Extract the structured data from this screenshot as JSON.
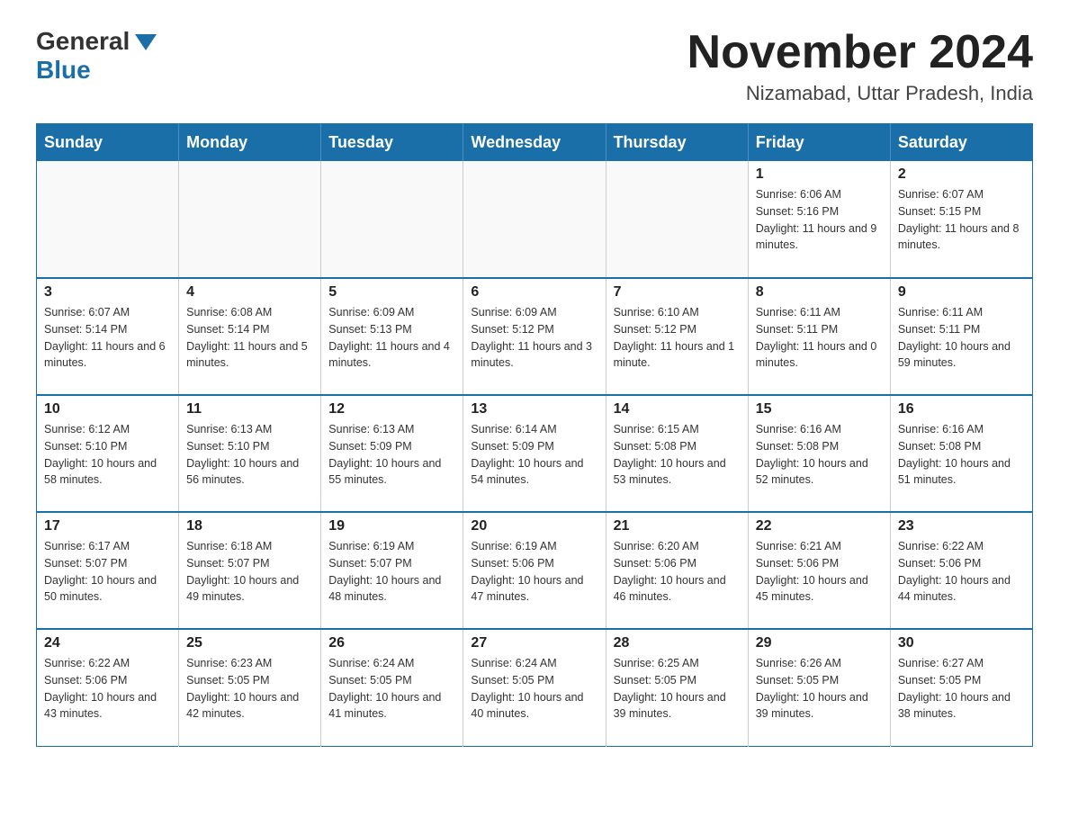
{
  "header": {
    "logo": {
      "general": "General",
      "blue": "Blue"
    },
    "title": "November 2024",
    "location": "Nizamabad, Uttar Pradesh, India"
  },
  "calendar": {
    "days_of_week": [
      "Sunday",
      "Monday",
      "Tuesday",
      "Wednesday",
      "Thursday",
      "Friday",
      "Saturday"
    ],
    "weeks": [
      [
        {
          "day": "",
          "info": ""
        },
        {
          "day": "",
          "info": ""
        },
        {
          "day": "",
          "info": ""
        },
        {
          "day": "",
          "info": ""
        },
        {
          "day": "",
          "info": ""
        },
        {
          "day": "1",
          "info": "Sunrise: 6:06 AM\nSunset: 5:16 PM\nDaylight: 11 hours and 9 minutes."
        },
        {
          "day": "2",
          "info": "Sunrise: 6:07 AM\nSunset: 5:15 PM\nDaylight: 11 hours and 8 minutes."
        }
      ],
      [
        {
          "day": "3",
          "info": "Sunrise: 6:07 AM\nSunset: 5:14 PM\nDaylight: 11 hours and 6 minutes."
        },
        {
          "day": "4",
          "info": "Sunrise: 6:08 AM\nSunset: 5:14 PM\nDaylight: 11 hours and 5 minutes."
        },
        {
          "day": "5",
          "info": "Sunrise: 6:09 AM\nSunset: 5:13 PM\nDaylight: 11 hours and 4 minutes."
        },
        {
          "day": "6",
          "info": "Sunrise: 6:09 AM\nSunset: 5:12 PM\nDaylight: 11 hours and 3 minutes."
        },
        {
          "day": "7",
          "info": "Sunrise: 6:10 AM\nSunset: 5:12 PM\nDaylight: 11 hours and 1 minute."
        },
        {
          "day": "8",
          "info": "Sunrise: 6:11 AM\nSunset: 5:11 PM\nDaylight: 11 hours and 0 minutes."
        },
        {
          "day": "9",
          "info": "Sunrise: 6:11 AM\nSunset: 5:11 PM\nDaylight: 10 hours and 59 minutes."
        }
      ],
      [
        {
          "day": "10",
          "info": "Sunrise: 6:12 AM\nSunset: 5:10 PM\nDaylight: 10 hours and 58 minutes."
        },
        {
          "day": "11",
          "info": "Sunrise: 6:13 AM\nSunset: 5:10 PM\nDaylight: 10 hours and 56 minutes."
        },
        {
          "day": "12",
          "info": "Sunrise: 6:13 AM\nSunset: 5:09 PM\nDaylight: 10 hours and 55 minutes."
        },
        {
          "day": "13",
          "info": "Sunrise: 6:14 AM\nSunset: 5:09 PM\nDaylight: 10 hours and 54 minutes."
        },
        {
          "day": "14",
          "info": "Sunrise: 6:15 AM\nSunset: 5:08 PM\nDaylight: 10 hours and 53 minutes."
        },
        {
          "day": "15",
          "info": "Sunrise: 6:16 AM\nSunset: 5:08 PM\nDaylight: 10 hours and 52 minutes."
        },
        {
          "day": "16",
          "info": "Sunrise: 6:16 AM\nSunset: 5:08 PM\nDaylight: 10 hours and 51 minutes."
        }
      ],
      [
        {
          "day": "17",
          "info": "Sunrise: 6:17 AM\nSunset: 5:07 PM\nDaylight: 10 hours and 50 minutes."
        },
        {
          "day": "18",
          "info": "Sunrise: 6:18 AM\nSunset: 5:07 PM\nDaylight: 10 hours and 49 minutes."
        },
        {
          "day": "19",
          "info": "Sunrise: 6:19 AM\nSunset: 5:07 PM\nDaylight: 10 hours and 48 minutes."
        },
        {
          "day": "20",
          "info": "Sunrise: 6:19 AM\nSunset: 5:06 PM\nDaylight: 10 hours and 47 minutes."
        },
        {
          "day": "21",
          "info": "Sunrise: 6:20 AM\nSunset: 5:06 PM\nDaylight: 10 hours and 46 minutes."
        },
        {
          "day": "22",
          "info": "Sunrise: 6:21 AM\nSunset: 5:06 PM\nDaylight: 10 hours and 45 minutes."
        },
        {
          "day": "23",
          "info": "Sunrise: 6:22 AM\nSunset: 5:06 PM\nDaylight: 10 hours and 44 minutes."
        }
      ],
      [
        {
          "day": "24",
          "info": "Sunrise: 6:22 AM\nSunset: 5:06 PM\nDaylight: 10 hours and 43 minutes."
        },
        {
          "day": "25",
          "info": "Sunrise: 6:23 AM\nSunset: 5:05 PM\nDaylight: 10 hours and 42 minutes."
        },
        {
          "day": "26",
          "info": "Sunrise: 6:24 AM\nSunset: 5:05 PM\nDaylight: 10 hours and 41 minutes."
        },
        {
          "day": "27",
          "info": "Sunrise: 6:24 AM\nSunset: 5:05 PM\nDaylight: 10 hours and 40 minutes."
        },
        {
          "day": "28",
          "info": "Sunrise: 6:25 AM\nSunset: 5:05 PM\nDaylight: 10 hours and 39 minutes."
        },
        {
          "day": "29",
          "info": "Sunrise: 6:26 AM\nSunset: 5:05 PM\nDaylight: 10 hours and 39 minutes."
        },
        {
          "day": "30",
          "info": "Sunrise: 6:27 AM\nSunset: 5:05 PM\nDaylight: 10 hours and 38 minutes."
        }
      ]
    ]
  }
}
